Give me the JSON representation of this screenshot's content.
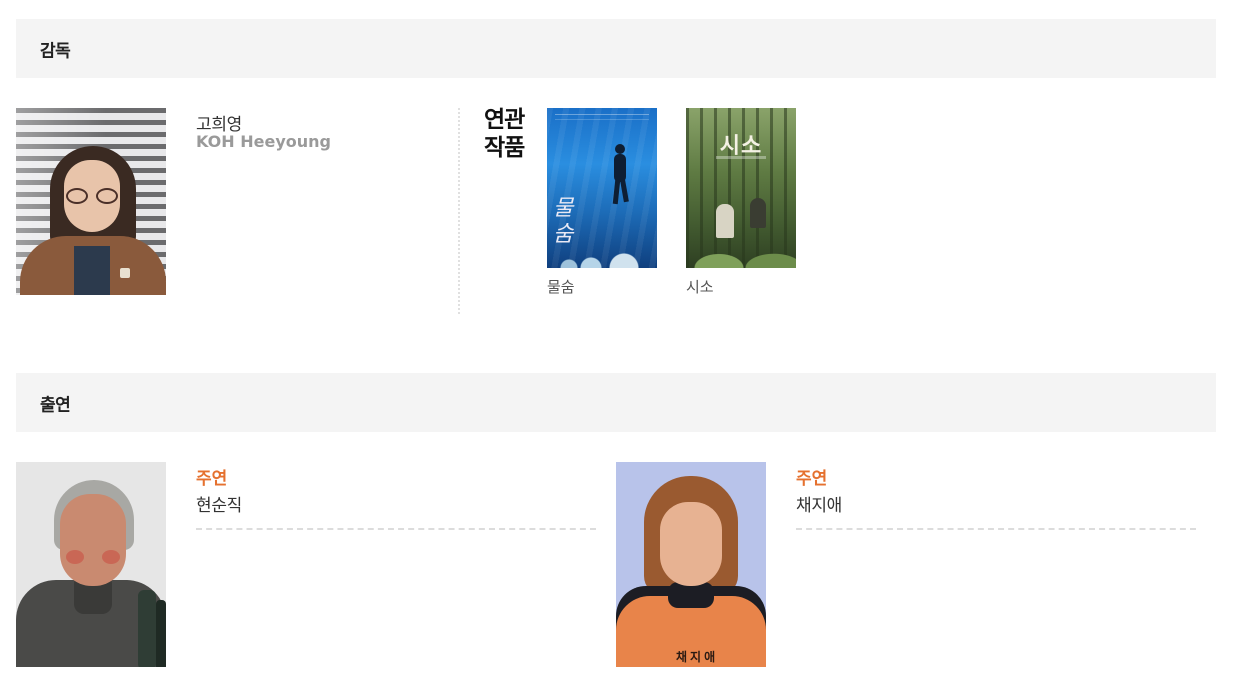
{
  "director_section": {
    "title": "감독",
    "director": {
      "name_ko": "고희영",
      "name_en": "KOH Heeyoung"
    },
    "related_label": "연관\n작품",
    "related_works": [
      {
        "title": "물숨",
        "poster_text": "물숨"
      },
      {
        "title": "시소",
        "poster_text": "시소"
      }
    ]
  },
  "cast_section": {
    "title": "출연",
    "members": [
      {
        "role": "주연",
        "name": "현순직"
      },
      {
        "role": "주연",
        "name": "채지애",
        "vest_text": "채지애"
      }
    ]
  },
  "colors": {
    "section_bar": "#f4f4f4",
    "role_accent": "#e5712f",
    "english_name": "#9a9a9a"
  }
}
